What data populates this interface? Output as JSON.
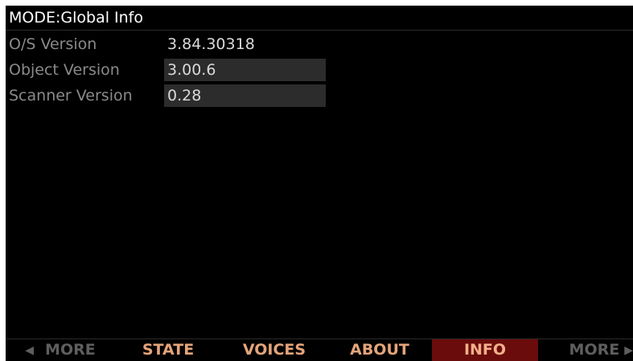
{
  "header": {
    "title": "MODE:Global Info"
  },
  "info": {
    "rows": [
      {
        "label": "O/S Version",
        "value": "3.84.30318"
      },
      {
        "label": "Object Version",
        "value": "3.00.6"
      },
      {
        "label": "Scanner Version",
        "value": "0.28"
      }
    ]
  },
  "softkeys": {
    "more_left": {
      "arrow": "◀",
      "label": "MORE"
    },
    "state": "STATE",
    "voices": "VOICES",
    "about": "ABOUT",
    "info": "INFO",
    "more_right": {
      "arrow": "▶",
      "label": "MORE"
    },
    "active": "INFO"
  },
  "colors": {
    "background": "#000000",
    "label_text": "#8a8a8a",
    "value_text": "#d9d9d9",
    "value_field": "#2c2c2c",
    "softkey_orange": "#e4a47a",
    "softkey_dim": "#5e5e5e",
    "active_tab": "#6b0c0c"
  },
  "icons": {
    "left_arrow": "triangle-left-icon",
    "right_arrow": "triangle-right-icon"
  }
}
